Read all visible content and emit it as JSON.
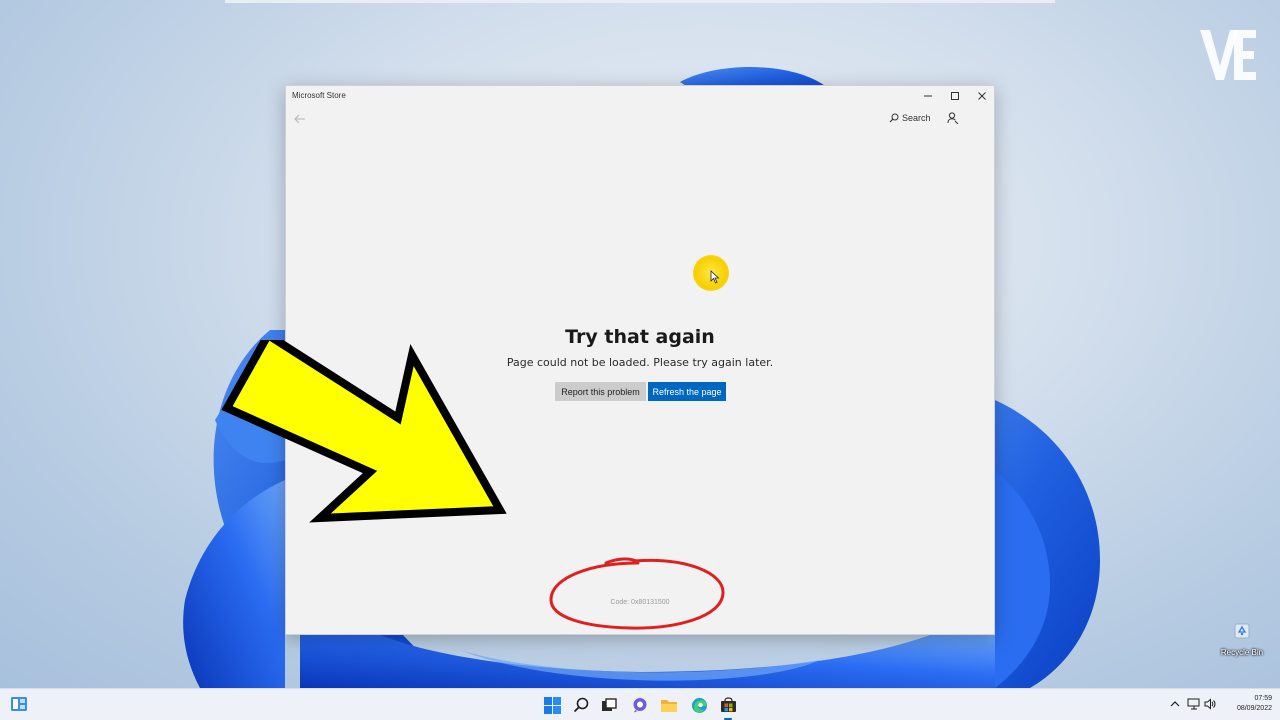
{
  "window": {
    "title": "Microsoft Store",
    "search_label": "Search"
  },
  "error": {
    "title": "Try that again",
    "message": "Page could not be loaded. Please try again later.",
    "report_button": "Report this problem",
    "refresh_button": "Refresh the page",
    "code": "Code: 0x80131500"
  },
  "desktop": {
    "recycle_bin_label": "Recycle Bin"
  },
  "taskbar": {
    "time": "07:59",
    "date": "08/09/2022",
    "icons": [
      "widgets-icon",
      "start-icon",
      "search-icon",
      "task-view-icon",
      "chat-icon",
      "file-explorer-icon",
      "edge-icon",
      "store-icon"
    ]
  },
  "colors": {
    "accent": "#0067c0",
    "annotation_arrow": "#ffff00",
    "annotation_circle": "#e0201e",
    "cursor_highlight": "#f5d000"
  }
}
